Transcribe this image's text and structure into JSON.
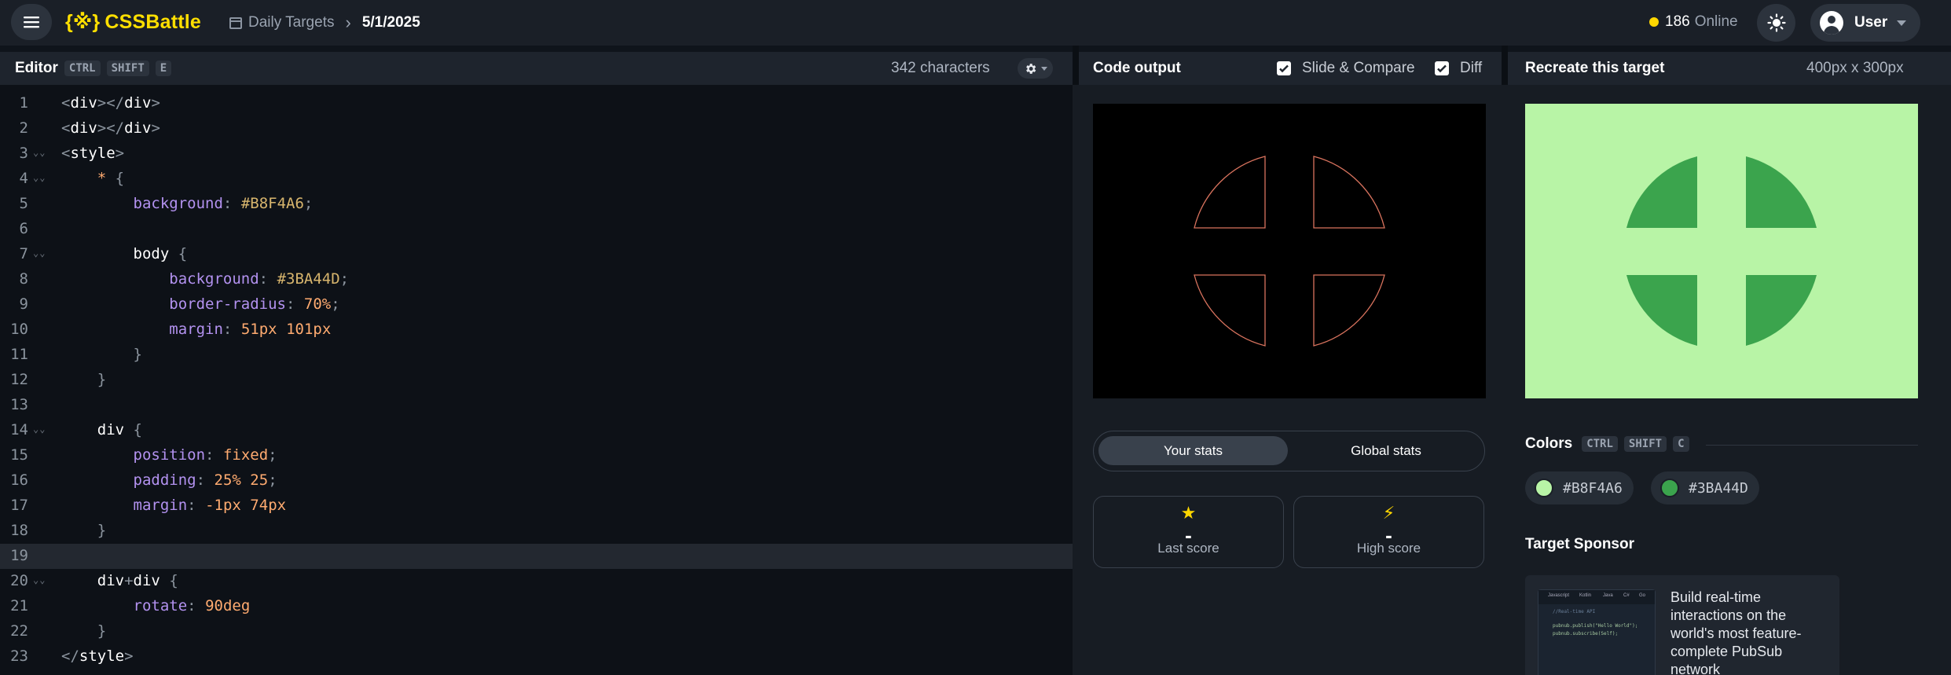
{
  "topbar": {
    "logo_mark": "{※}",
    "logo_text": "CSSBattle",
    "breadcrumb_section": "Daily Targets",
    "breadcrumb_separator": "›",
    "breadcrumb_current": "5/1/2025",
    "online_count": "186",
    "online_label": "Online",
    "user_name": "User"
  },
  "editor": {
    "title": "Editor",
    "shortcut": [
      "CTRL",
      "SHIFT",
      "E"
    ],
    "char_count": "342 characters",
    "active_line": 19,
    "lines": [
      {
        "n": "1",
        "fold": false
      },
      {
        "n": "2",
        "fold": false
      },
      {
        "n": "3",
        "fold": true
      },
      {
        "n": "4",
        "fold": true
      },
      {
        "n": "5",
        "fold": false
      },
      {
        "n": "6",
        "fold": false
      },
      {
        "n": "7",
        "fold": true
      },
      {
        "n": "8",
        "fold": false
      },
      {
        "n": "9",
        "fold": false
      },
      {
        "n": "10",
        "fold": false
      },
      {
        "n": "11",
        "fold": false
      },
      {
        "n": "12",
        "fold": false
      },
      {
        "n": "13",
        "fold": false
      },
      {
        "n": "14",
        "fold": true
      },
      {
        "n": "15",
        "fold": false
      },
      {
        "n": "16",
        "fold": false
      },
      {
        "n": "17",
        "fold": false
      },
      {
        "n": "18",
        "fold": false
      },
      {
        "n": "19",
        "fold": false
      },
      {
        "n": "20",
        "fold": true
      },
      {
        "n": "21",
        "fold": false
      },
      {
        "n": "22",
        "fold": false
      },
      {
        "n": "23",
        "fold": false
      }
    ],
    "code": {
      "l1_open": "<",
      "l1_tag": "div",
      "l1_mid": "></",
      "l1_tag2": "div",
      "l1_close": ">",
      "l2_open": "<",
      "l2_tag": "div",
      "l2_mid": "></",
      "l2_tag2": "div",
      "l2_close": ">",
      "l3_open": "<",
      "l3_tag": "style",
      "l3_close": ">",
      "l4_sel": "*",
      "l4_brace": "{",
      "l5_prop": "background",
      "l5_colon": ":",
      "l5_val": "#B8F4A6",
      "l5_semi": ";",
      "l7_sel": "body",
      "l7_brace": "{",
      "l8_prop": "background",
      "l8_colon": ":",
      "l8_val": "#3BA44D",
      "l8_semi": ";",
      "l9_prop": "border-radius",
      "l9_colon": ":",
      "l9_num": "70",
      "l9_unit": "%",
      "l9_semi": ";",
      "l10_prop": "margin",
      "l10_colon": ":",
      "l10_num1": "51",
      "l10_unit1": "px",
      "l10_num2": "101",
      "l10_unit2": "px",
      "l11_brace": "}",
      "l12_brace": "}",
      "l14_sel": "div",
      "l14_brace": "{",
      "l15_prop": "position",
      "l15_colon": ":",
      "l15_val": "fixed",
      "l15_semi": ";",
      "l16_prop": "padding",
      "l16_colon": ":",
      "l16_num1": "25",
      "l16_unit1": "%",
      "l16_num2": "25",
      "l16_semi": ";",
      "l17_prop": "margin",
      "l17_colon": ":",
      "l17_num1": "-1",
      "l17_unit1": "px",
      "l17_num2": "74",
      "l17_unit2": "px",
      "l18_brace": "}",
      "l20_sel1": "div",
      "l20_plus": "+",
      "l20_sel2": "div",
      "l20_brace": "{",
      "l21_prop": "rotate",
      "l21_colon": ":",
      "l21_num": "90",
      "l21_unit": "deg",
      "l22_brace": "}",
      "l23_open": "</",
      "l23_tag": "style",
      "l23_close": ">"
    }
  },
  "output": {
    "title": "Code output",
    "slide_compare_label": "Slide & Compare",
    "diff_label": "Diff",
    "slide_compare_checked": true,
    "diff_checked": true,
    "tab_your": "Your stats",
    "tab_global": "Global stats",
    "last_score_value": "-",
    "last_score_label": "Last score",
    "high_score_value": "-",
    "high_score_label": "High score"
  },
  "target": {
    "title": "Recreate this target",
    "dimensions": "400px x 300px",
    "colors_title": "Colors",
    "colors_shortcut": [
      "CTRL",
      "SHIFT",
      "C"
    ],
    "colors": [
      {
        "hex": "#B8F4A6",
        "swatch": "#b8f4a6"
      },
      {
        "hex": "#3BA44D",
        "swatch": "#3ba44d"
      }
    ],
    "sponsor_title": "Target Sponsor",
    "sponsor_text": "Build real-time interactions on the world's most feature-complete PubSub network",
    "sponsor_tabs": [
      "Javascript",
      "Kotlin",
      "Java",
      "C#",
      "Go"
    ],
    "sponsor_code": [
      "//Real-time API",
      "pubnub.publish(\"Hello World\");",
      "pubnub.subscribe(Self);"
    ]
  },
  "theme": {
    "accent": "#ffdf00",
    "background_color": "#B8F4A6",
    "shape_color": "#3BA44D"
  }
}
